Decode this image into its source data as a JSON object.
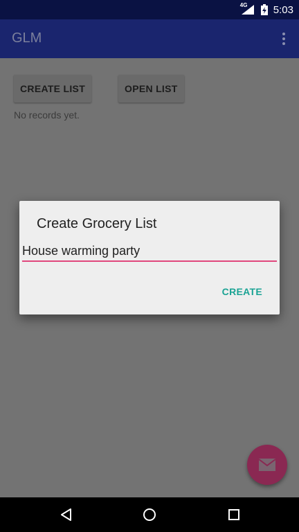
{
  "status_bar": {
    "time": "5:03",
    "network": "4G",
    "icons": [
      "signal-icon",
      "battery-icon"
    ]
  },
  "app_bar": {
    "title": "GLM",
    "menu_icon": "overflow-menu-icon"
  },
  "main": {
    "create_list_label": "CREATE LIST",
    "open_list_label": "OPEN LIST",
    "empty_text": "No records yet."
  },
  "dialog": {
    "title": "Create Grocery List",
    "input_value": "House warming party",
    "create_label": "CREATE"
  },
  "fab": {
    "icon": "mail-icon"
  },
  "nav_bar": {
    "icons": [
      "back-icon",
      "home-icon",
      "recents-icon"
    ]
  },
  "colors": {
    "status_bar": "#0a1243",
    "app_bar": "#1a256e",
    "accent": "#e0467c",
    "dialog_action": "#1aa394",
    "fab": "#8a2852"
  }
}
